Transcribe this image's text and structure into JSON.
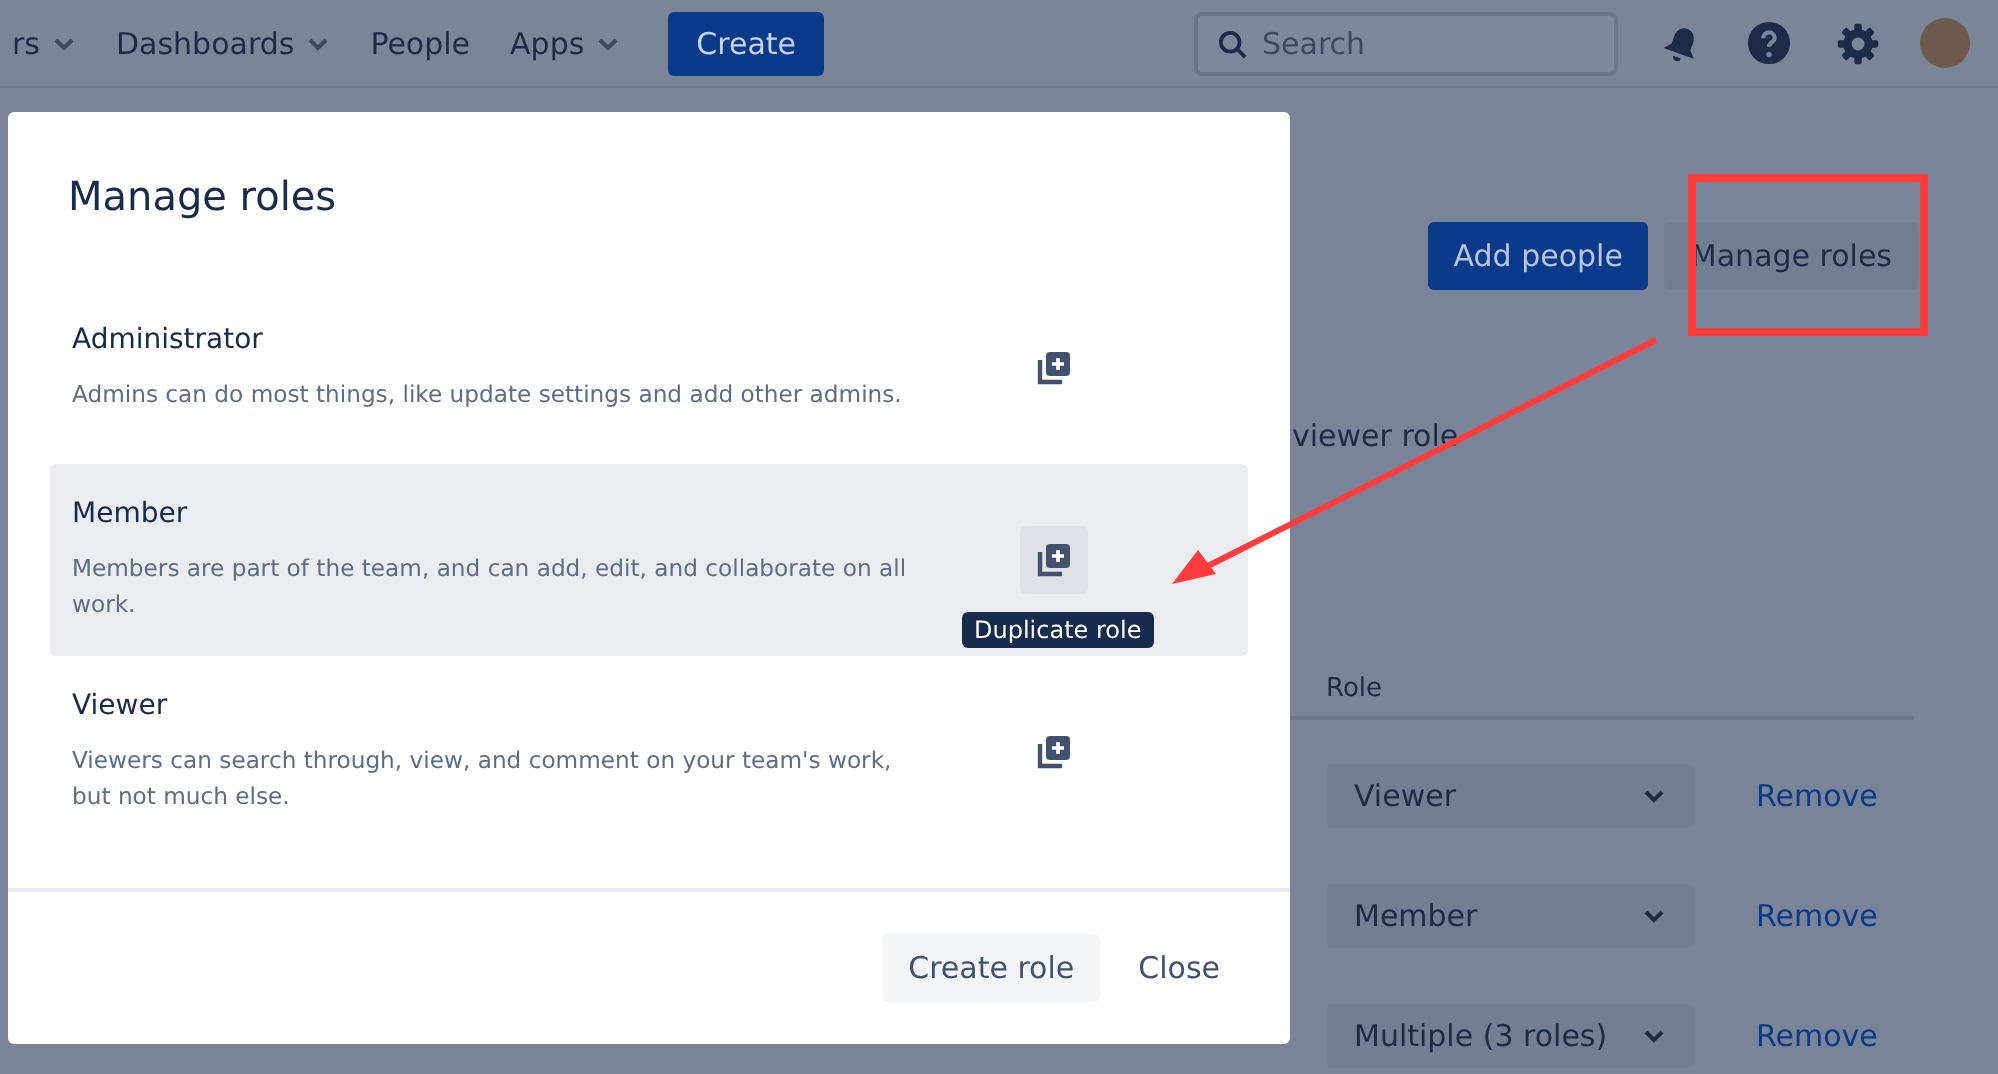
{
  "nav": {
    "items": [
      {
        "label": "rs",
        "dropdown": true
      },
      {
        "label": "Dashboards",
        "dropdown": true
      },
      {
        "label": "People",
        "dropdown": false
      },
      {
        "label": "Apps",
        "dropdown": true
      }
    ],
    "create": "Create",
    "search": {
      "placeholder": "Search"
    }
  },
  "page": {
    "buttons": [
      {
        "label": "Add people",
        "kind": "primary"
      },
      {
        "label": "Manage roles",
        "kind": "subtle"
      }
    ],
    "note": "viewer role",
    "table": {
      "columns": [
        "Role"
      ],
      "rows": [
        {
          "role": "Viewer",
          "action": "Remove"
        },
        {
          "role": "Member",
          "action": "Remove"
        },
        {
          "role": "Multiple (3 roles)",
          "action": "Remove"
        }
      ]
    }
  },
  "dialog": {
    "title": "Manage roles",
    "roles": [
      {
        "name": "Administrator",
        "description": "Admins can do most things, like update settings and add other admins.",
        "hovered": false
      },
      {
        "name": "Member",
        "description": "Members are part of the team, and can add, edit, and collaborate on all work.",
        "hovered": true,
        "tooltip": "Duplicate role"
      },
      {
        "name": "Viewer",
        "description": "Viewers can search through, view, and comment on your team's work, but not much else.",
        "hovered": false
      }
    ],
    "footer": [
      {
        "label": "Create role",
        "kind": "secondary"
      },
      {
        "label": "Close",
        "kind": "subtle"
      }
    ]
  }
}
